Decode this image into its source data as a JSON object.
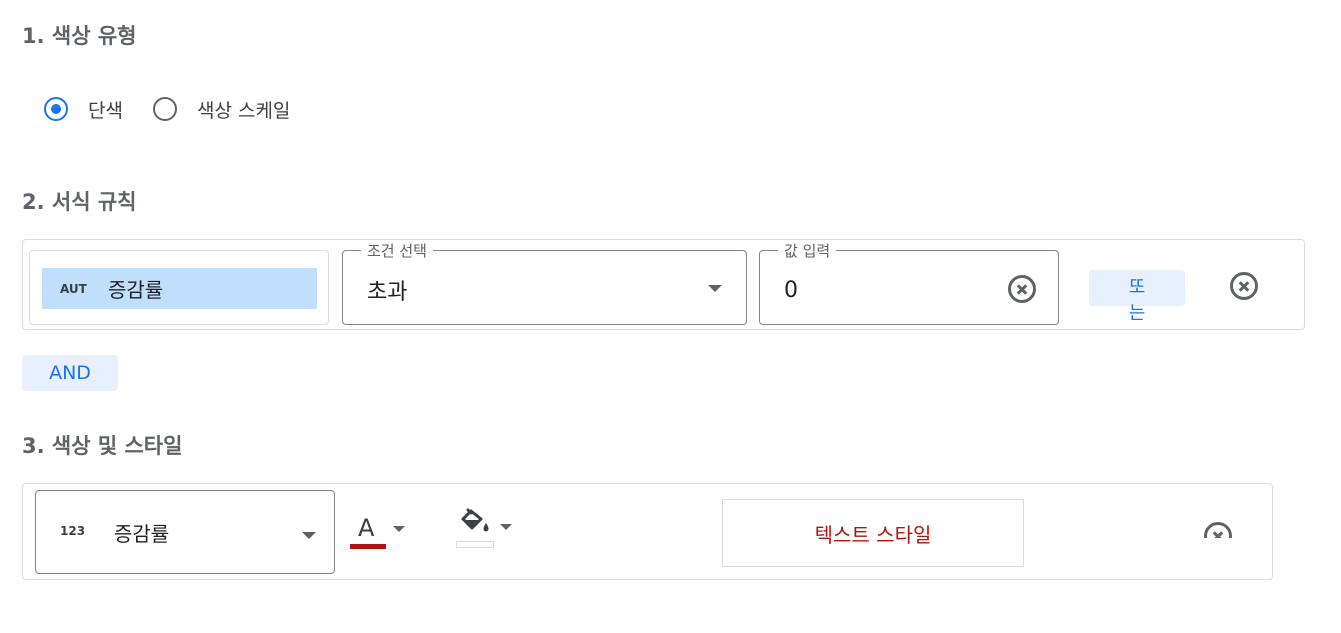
{
  "section1": {
    "title": "1. 색상 유형"
  },
  "color_type": {
    "options": [
      {
        "label": "단색",
        "checked": true
      },
      {
        "label": "색상 스케일",
        "checked": false
      }
    ]
  },
  "section2": {
    "title": "2. 서식 규칙"
  },
  "rule": {
    "field_type": "AUT",
    "field_name": "증감률",
    "condition_legend": "조건 선택",
    "condition_value": "초과",
    "value_legend": "값 입력",
    "value": "0",
    "or_label": "또는"
  },
  "and_label": "AND",
  "section3": {
    "title": "3. 색상 및 스타일"
  },
  "style": {
    "metric_type": "123",
    "metric_name": "증감률",
    "text_color_letter": "A",
    "text_color": "#b31412",
    "fill_color": "#ffffff",
    "preview_text": "텍스트 스타일"
  },
  "colors": {
    "accent": "#1a73e8",
    "chip_bg": "#bfdffc",
    "button_bg": "#e8f0fe"
  }
}
